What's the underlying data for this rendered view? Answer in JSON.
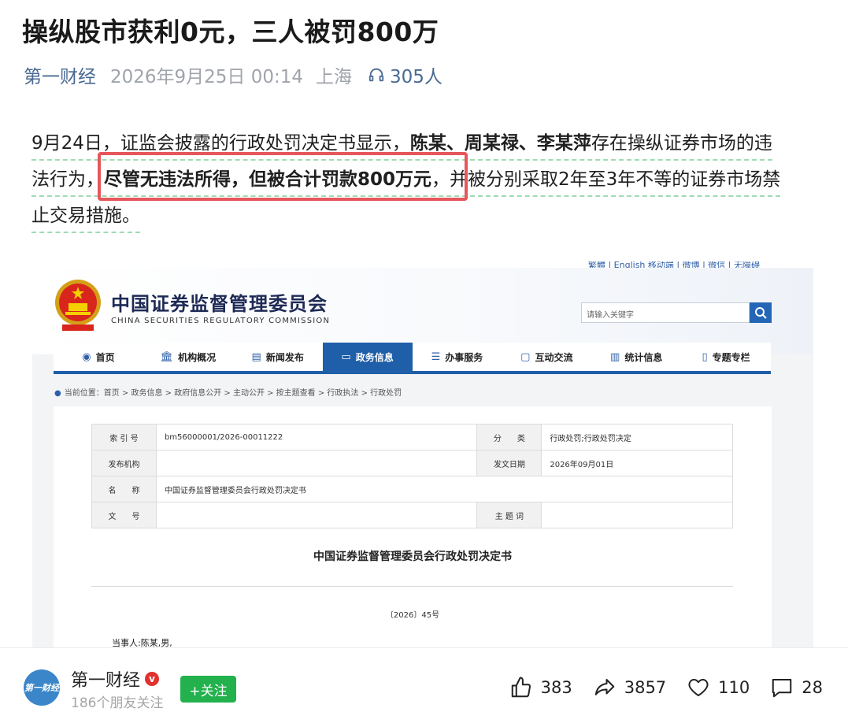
{
  "article": {
    "title": "操纵股市获利0元，三人被罚800万",
    "source": "第一财经",
    "time": "2026年9月25日 00:14",
    "city": "上海",
    "readers": "305人",
    "paragraph": {
      "l1_a": "9月24日，证监会披露的行政处罚决定书显示，",
      "l1_b": "陈某、周某禄、李某萍",
      "l1_c": "存在操纵证券市场的违",
      "l2_a": "法行为，",
      "l2_b": "尽管无违法所得，但被合计罚款800万元",
      "l2_c": "，并被分别采取2年至3年不等的证券市场禁",
      "l3": "止交易措施。"
    }
  },
  "screenshot": {
    "top_links": "繁體 | English        移动端  |  微博  |  微信  |  无障碍",
    "org_cn": "中国证券监督管理委员会",
    "org_en": "CHINA SECURITIES REGULATORY COMMISSION",
    "search_placeholder": "请输入关键字",
    "nav": [
      {
        "label": "首页",
        "icon": "emblem-icon"
      },
      {
        "label": "机构概况",
        "icon": "building-icon"
      },
      {
        "label": "新闻发布",
        "icon": "news-icon"
      },
      {
        "label": "政务信息",
        "icon": "monitor-icon"
      },
      {
        "label": "办事服务",
        "icon": "form-icon"
      },
      {
        "label": "互动交流",
        "icon": "chat-icon"
      },
      {
        "label": "统计信息",
        "icon": "bars-icon"
      },
      {
        "label": "专题专栏",
        "icon": "doc-icon"
      }
    ],
    "breadcrumb": "当前位置：首页 > 政务信息 > 政府信息公开 > 主动公开 > 按主题查看 > 行政执法 > 行政处罚",
    "table": {
      "r1": {
        "k1": "索 引 号",
        "v1": "bm56000001/2026-00011222",
        "k2": "分　　类",
        "v2": "行政处罚;行政处罚决定"
      },
      "r2": {
        "k1": "发布机构",
        "v1": "",
        "k2": "发文日期",
        "v2": "2026年09月01日"
      },
      "r3": {
        "k1": "名　　称",
        "v1": "中国证券监督管理委员会行政处罚决定书"
      },
      "r4": {
        "k1": "文　　号",
        "v1": "",
        "k2": "主 题 词",
        "v2": ""
      }
    },
    "doc_title": "中国证券监督管理委员会行政处罚决定书",
    "doc_no": "〔2026〕45号",
    "party": "当事人:陈某,男,"
  },
  "footer": {
    "avatar_text": "第一财经",
    "account": "第一财经",
    "verified": "v",
    "followers": "186个朋友关注",
    "follow": "+关注",
    "likes": "383",
    "shares": "3857",
    "favorites": "110",
    "comments": "28"
  },
  "colors": {
    "accent_blue": "#1f5ea8",
    "highlight_red": "#e6575c",
    "follow_green": "#22b14c",
    "source_blue": "#4a6a93"
  }
}
